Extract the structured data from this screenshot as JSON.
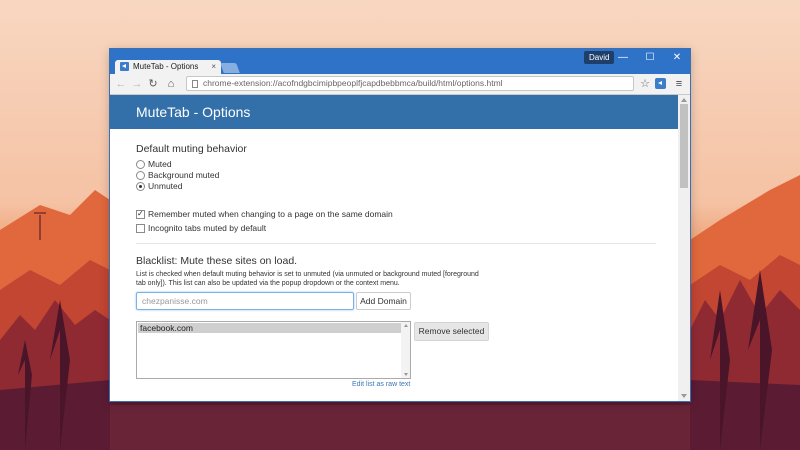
{
  "window": {
    "user_badge": "David",
    "controls": {
      "minimize": "—",
      "maximize": "☐",
      "close": "✕"
    },
    "tab": {
      "title": "MuteTab - Options",
      "close": "×"
    }
  },
  "toolbar": {
    "back": "←",
    "forward": "→",
    "reload": "↻",
    "home": "⌂",
    "url": "chrome-extension://acofndgbcimipbpeoplfjcapdbebbmca/build/html/options.html",
    "star": "☆",
    "menu": "≡"
  },
  "page": {
    "header_title": "MuteTab - Options",
    "default_muting": {
      "heading": "Default muting behavior",
      "options": [
        {
          "label": "Muted",
          "checked": false
        },
        {
          "label": "Background muted",
          "checked": false
        },
        {
          "label": "Unmuted",
          "checked": true
        }
      ]
    },
    "checkboxes": [
      {
        "label": "Remember muted when changing to a page on the same domain",
        "checked": true
      },
      {
        "label": "Incognito tabs muted by default",
        "checked": false
      }
    ],
    "blacklist": {
      "heading": "Blacklist: Mute these sites on load.",
      "help_text": "List is checked when default muting behavior is set to unmuted (via unmuted or background muted [foreground tab only]). This list can also be updated via the popup dropdown or the context menu.",
      "input_placeholder": "chezpanisse.com",
      "add_button": "Add Domain",
      "items": [
        "facebook.com"
      ],
      "remove_button": "Remove selected",
      "raw_link": "Edit list as raw text"
    }
  },
  "colors": {
    "titlebar": "#2f73c8",
    "page_header": "#336fa9",
    "link": "#3876b7"
  }
}
